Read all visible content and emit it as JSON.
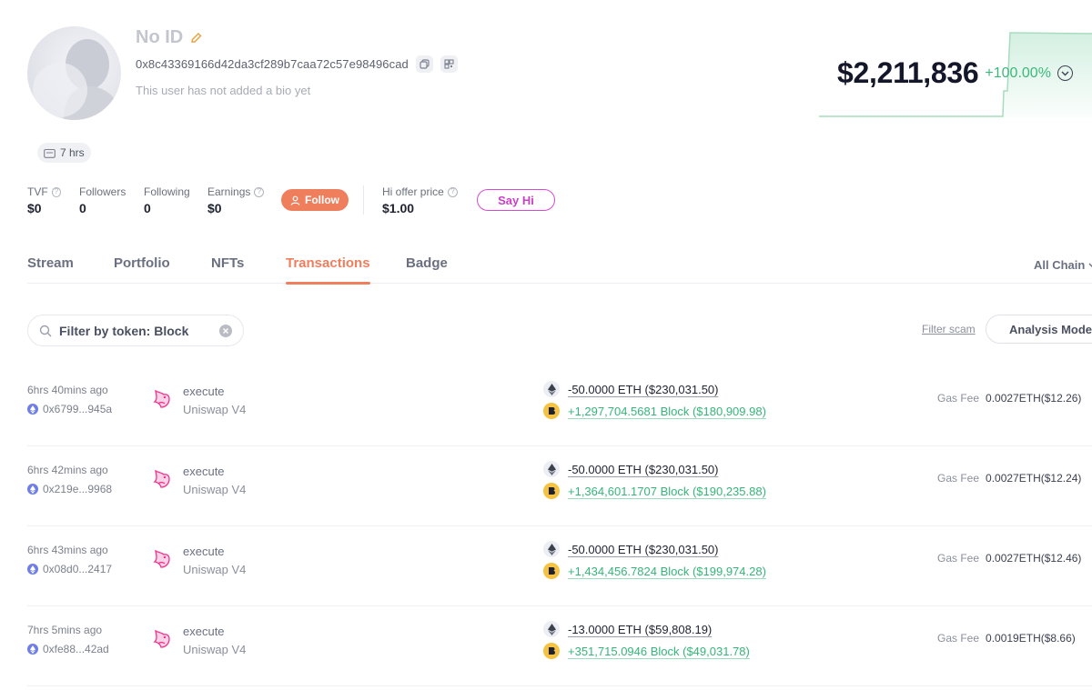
{
  "profile": {
    "name": "No ID",
    "address": "0x8c43369166d42da3cf289b7caa72c57e98496cad",
    "bio": "This user has not added a bio yet",
    "active_ago": "7 hrs"
  },
  "stats": [
    {
      "label": "TVF",
      "value": "$0",
      "help": true
    },
    {
      "label": "Followers",
      "value": "0",
      "help": false
    },
    {
      "label": "Following",
      "value": "0",
      "help": false
    },
    {
      "label": "Earnings",
      "value": "$0",
      "help": true
    }
  ],
  "follow_label": "Follow",
  "hi_offer": {
    "label": "Hi offer price",
    "value": "$1.00"
  },
  "say_hi_label": "Say Hi",
  "networth": {
    "value": "$2,211,836",
    "change": "+100.00%"
  },
  "colors": {
    "accent": "#ef7e5d",
    "positive": "#3bb97a",
    "say_hi": "#c93fc6"
  },
  "tabs": [
    {
      "label": "Stream",
      "active": false
    },
    {
      "label": "Portfolio",
      "active": false
    },
    {
      "label": "NFTs",
      "active": false
    },
    {
      "label": "Transactions",
      "active": true
    },
    {
      "label": "Badge",
      "active": false
    }
  ],
  "chain_filter": "All Chain",
  "filter": {
    "value": "Filter by token: Block",
    "placeholder": "Filter by token"
  },
  "filter_scam_label": "Filter scam",
  "analysis_mode_label": "Analysis Mode",
  "transactions": [
    {
      "time": "6hrs 40mins ago",
      "hash": "0x6799...945a",
      "method": "execute",
      "protocol": "Uniswap V4",
      "out": "-50.0000 ETH ($230,031.50)",
      "in": "+1,297,704.5681 Block ($180,909.98)",
      "gas_label": "Gas Fee",
      "gas": "0.0027ETH($12.26)"
    },
    {
      "time": "6hrs 42mins ago",
      "hash": "0x219e...9968",
      "method": "execute",
      "protocol": "Uniswap V4",
      "out": "-50.0000 ETH ($230,031.50)",
      "in": "+1,364,601.1707 Block ($190,235.88)",
      "gas_label": "Gas Fee",
      "gas": "0.0027ETH($12.24)"
    },
    {
      "time": "6hrs 43mins ago",
      "hash": "0x08d0...2417",
      "method": "execute",
      "protocol": "Uniswap V4",
      "out": "-50.0000 ETH ($230,031.50)",
      "in": "+1,434,456.7824 Block ($199,974.28)",
      "gas_label": "Gas Fee",
      "gas": "0.0027ETH($12.46)"
    },
    {
      "time": "7hrs 5mins ago",
      "hash": "0xfe88...42ad",
      "method": "execute",
      "protocol": "Uniswap V4",
      "out": "-13.0000 ETH ($59,808.19)",
      "in": "+351,715.0946 Block ($49,031.78)",
      "gas_label": "Gas Fee",
      "gas": "0.0019ETH($8.66)"
    }
  ]
}
